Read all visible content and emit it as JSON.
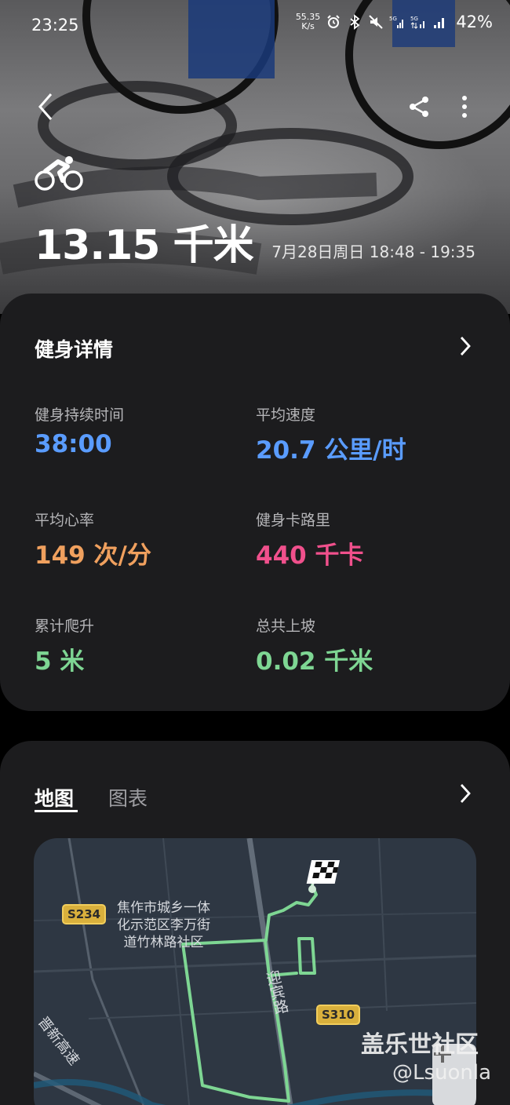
{
  "status_bar": {
    "time": "23:25",
    "net_speed_value": "55.35",
    "net_speed_unit": "K/s",
    "battery": "42%"
  },
  "workout": {
    "distance": "13.15 千米",
    "date_range": "7月28日周日 18:48 - 19:35"
  },
  "details": {
    "title": "健身详情",
    "metrics": [
      {
        "label": "健身持续时间",
        "value": "38:00",
        "color": "#5a9cff"
      },
      {
        "label": "平均速度",
        "value": "20.7 公里/时",
        "color": "#5a9cff"
      },
      {
        "label": "平均心率",
        "value": "149 次/分",
        "color": "#f0a05e"
      },
      {
        "label": "健身卡路里",
        "value": "440 千卡",
        "color": "#f0508c"
      },
      {
        "label": "累计爬升",
        "value": "5 米",
        "color": "#7ed693"
      },
      {
        "label": "总共上坡",
        "value": "0.02 千米",
        "color": "#7ed693"
      }
    ]
  },
  "map_card": {
    "tabs": [
      {
        "label": "地图",
        "active": true
      },
      {
        "label": "图表",
        "active": false
      }
    ],
    "map": {
      "road_badges": [
        "S234",
        "S310"
      ],
      "place_label": "焦作市城乡一体\n化示范区李万街\n道竹林路社区",
      "street_label": "迎宾路",
      "highway_label": "晋新高速",
      "route_color": "#7ed693"
    }
  },
  "watermark": {
    "line1": "盖乐世社区",
    "line2": "@Lsuonla"
  }
}
